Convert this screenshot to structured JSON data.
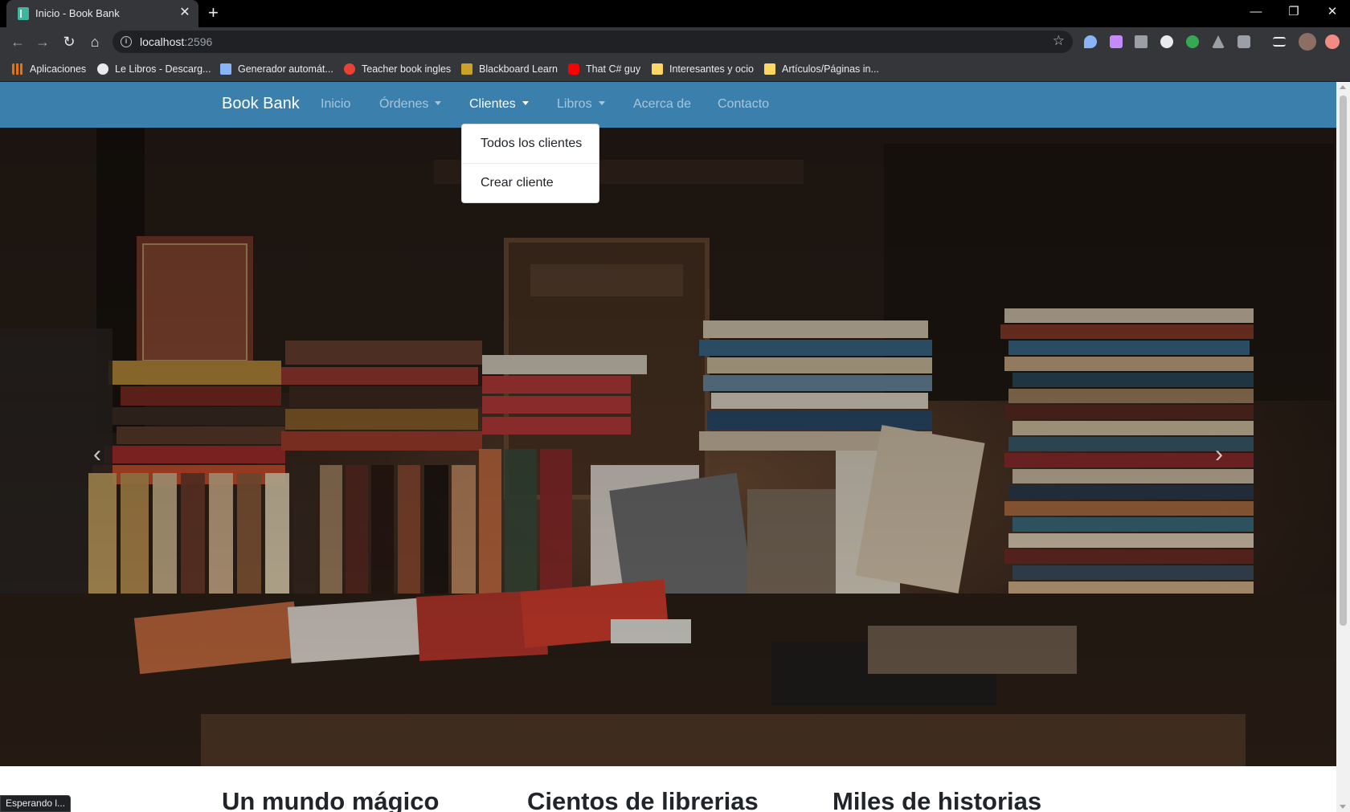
{
  "browser": {
    "tab": {
      "title": "Inicio - Book Bank",
      "close": "✕"
    },
    "new_tab": "+",
    "window_controls": {
      "minimize": "—",
      "restore": "❐",
      "close": "✕"
    },
    "nav_icons": {
      "back": "←",
      "forward": "→",
      "reload": "↻",
      "home": "⌂"
    },
    "address": {
      "host": "localhost",
      "port": ":2596"
    },
    "bookmarks": [
      {
        "label": "Aplicaciones",
        "icon": "apps-grid-icon",
        "color": "#e8710a"
      },
      {
        "label": "Le Libros - Descarg...",
        "icon": "globe-icon",
        "color": "#e8eaed"
      },
      {
        "label": "Generador automát...",
        "icon": "document-icon",
        "color": "#8ab4f8"
      },
      {
        "label": "Teacher book ingles",
        "icon": "target-icon",
        "color": "#ea4335"
      },
      {
        "label": "Blackboard Learn",
        "icon": "bb-icon",
        "color": "#c9a227"
      },
      {
        "label": "That C# guy",
        "icon": "youtube-icon",
        "color": "#ff0000"
      },
      {
        "label": "Interesantes y ocio",
        "icon": "folder-icon",
        "color": "#fdd663"
      },
      {
        "label": "Artículos/Páginas in...",
        "icon": "folder-icon",
        "color": "#fdd663"
      }
    ]
  },
  "site": {
    "brand": "Book Bank",
    "nav": [
      {
        "label": "Inicio",
        "dropdown": false,
        "active": false
      },
      {
        "label": "Órdenes",
        "dropdown": true,
        "active": false
      },
      {
        "label": "Clientes",
        "dropdown": true,
        "active": true
      },
      {
        "label": "Libros",
        "dropdown": true,
        "active": false
      },
      {
        "label": "Acerca de",
        "dropdown": false,
        "active": false
      },
      {
        "label": "Contacto",
        "dropdown": false,
        "active": false
      }
    ],
    "dropdown": [
      "Todos los clientes",
      "Crear cliente"
    ],
    "carousel": {
      "prev": "‹",
      "next": "›"
    },
    "features": [
      "Un mundo mágico",
      "Cientos de librerias",
      "Miles de historias"
    ],
    "status": "Esperando l...",
    "colors": {
      "navbar": "#3b7fad",
      "nav_link_muted": "rgba(255,255,255,0.55)",
      "text": "#212529"
    }
  }
}
